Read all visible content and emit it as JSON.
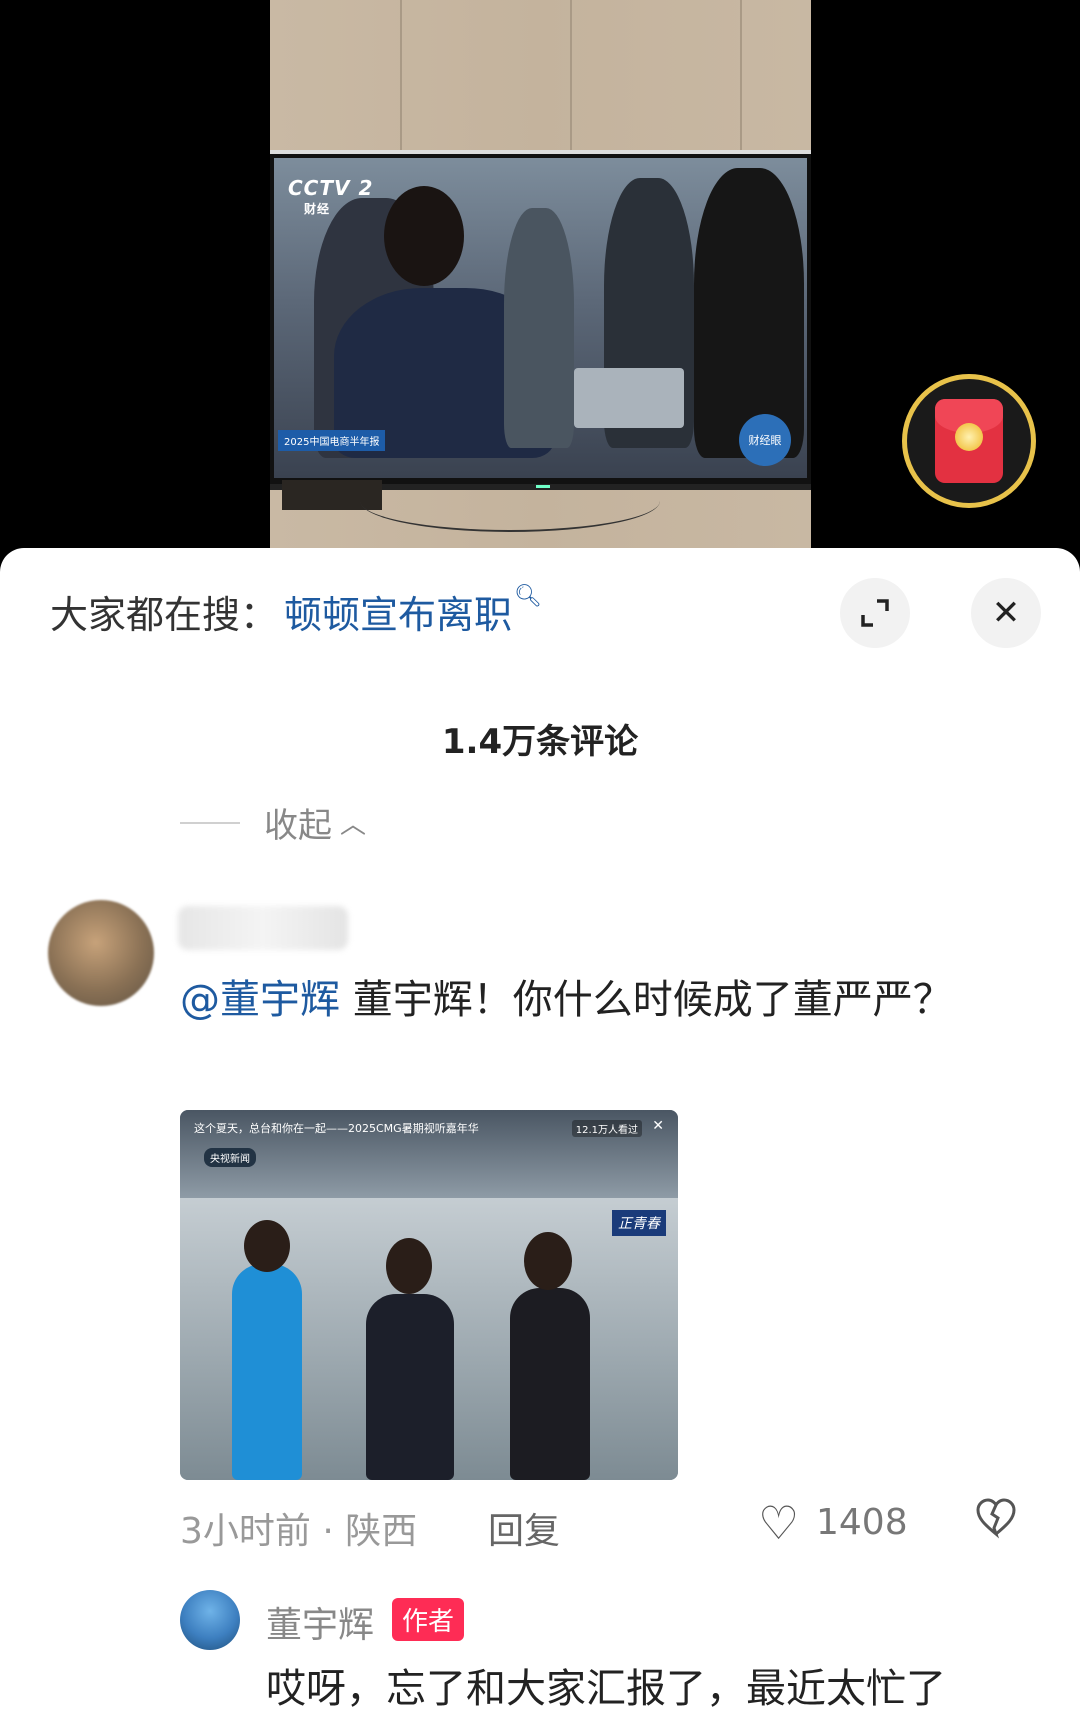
{
  "video": {
    "tv_channel": "CCTV 2",
    "tv_channel_sub": "财经",
    "tv_banner": "2025中国电商半年报",
    "tv_badge": "财经眼"
  },
  "search": {
    "prefix": "大家都在搜：",
    "term": "顿顿宣布离职"
  },
  "comments": {
    "count_label": "1.4万条评论",
    "collapse_label": "收起",
    "main": {
      "mention": "@董宇辉",
      "text": " 董宇辉！你什么时候成了董严严？",
      "image": {
        "title": "这个夏天，总台和你在一起——2025CMG暑期视听嘉年华",
        "views": "12.1万人看过",
        "chip": "央视新闻",
        "logo": "正青春"
      },
      "time": "3小时前 · 陕西",
      "reply_label": "回复",
      "like_count": "1408"
    },
    "reply": {
      "name": "董宇辉",
      "badge": "作者",
      "text": "哎呀，忘了和大家汇报了，最近太忙了"
    }
  },
  "colors": {
    "link": "#1e5aa0",
    "author_badge": "#fe2c55",
    "envelope": "#e33141"
  }
}
